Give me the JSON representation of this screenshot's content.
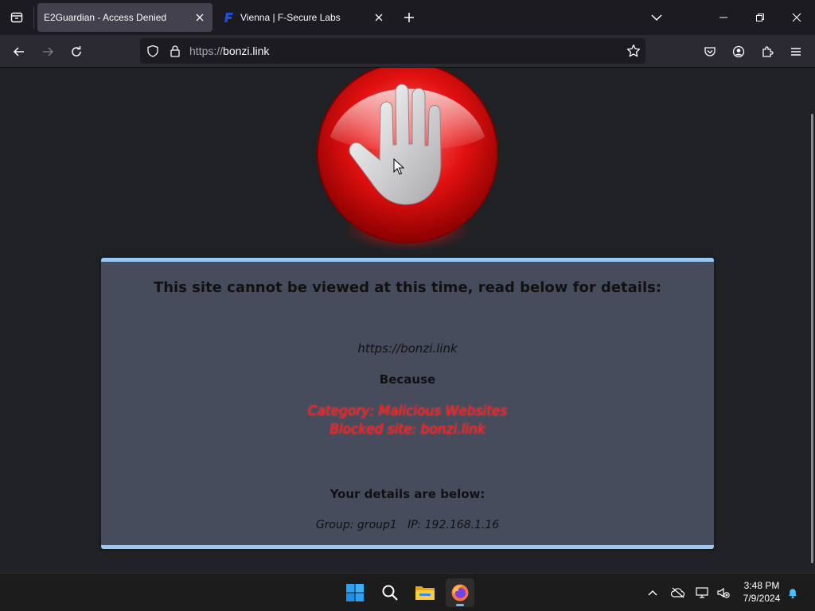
{
  "browser": {
    "tabs": [
      {
        "title": "E2Guardian - Access Denied",
        "active": true
      },
      {
        "title": "Vienna | F-Secure Labs",
        "active": false,
        "favicon": "f-secure-logo"
      }
    ],
    "url_scheme": "https://",
    "url_host": "bonzi.link"
  },
  "page": {
    "heading": "This site cannot be viewed at this time, read below for details:",
    "blocked_url": "https://bonzi.link",
    "because": "Because",
    "reason_line1": "Category: Malicious Websites",
    "reason_line2": "Blocked site: bonzi.link",
    "details_heading": "Your details are below:",
    "details": "Group: group1   IP: 192.168.1.16",
    "icon": "stop-hand-icon",
    "accent_color": "#99c8f4",
    "reason_color": "#ff1a1a"
  },
  "taskbar": {
    "apps": [
      "windows-start-icon",
      "search-icon",
      "file-explorer-icon",
      "firefox-icon"
    ],
    "time": "3:48 PM",
    "date": "7/9/2024"
  }
}
